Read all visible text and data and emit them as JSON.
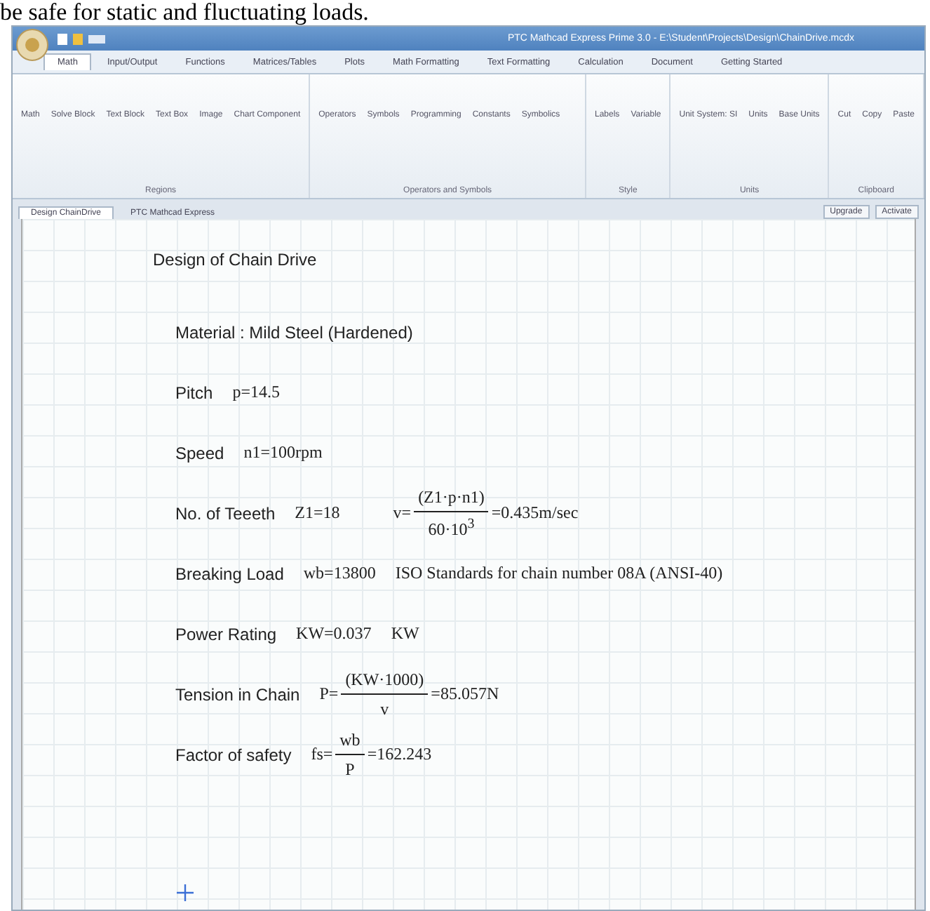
{
  "page_text": "be safe for static and fluctuating loads.",
  "window": {
    "title": "PTC Mathcad Express Prime 3.0 - E:\\Student\\Projects\\Design\\ChainDrive.mcdx"
  },
  "ribbon_tabs": [
    {
      "label": "Math",
      "selected": true
    },
    {
      "label": "Input/Output",
      "selected": false
    },
    {
      "label": "Functions",
      "selected": false
    },
    {
      "label": "Matrices/Tables",
      "selected": false
    },
    {
      "label": "Plots",
      "selected": false
    },
    {
      "label": "Math Formatting",
      "selected": false
    },
    {
      "label": "Text Formatting",
      "selected": false
    },
    {
      "label": "Calculation",
      "selected": false
    },
    {
      "label": "Document",
      "selected": false
    },
    {
      "label": "Getting Started",
      "selected": false
    }
  ],
  "ribbon_groups": [
    {
      "name": "Regions",
      "buttons": [
        "Math",
        "Solve Block",
        "Text Block",
        "Text Box",
        "Image",
        "Chart Component"
      ]
    },
    {
      "name": "Operators and Symbols",
      "buttons": [
        "Operators",
        "Symbols",
        "Programming",
        "Constants",
        "Symbolics"
      ]
    },
    {
      "name": "Style",
      "buttons": [
        "Labels",
        "Variable"
      ]
    },
    {
      "name": "Units",
      "buttons": [
        "Unit System: SI",
        "Units",
        "Base Units"
      ]
    },
    {
      "name": "Clipboard",
      "buttons": [
        "Cut",
        "Copy",
        "Paste"
      ]
    }
  ],
  "doc_tabs": [
    {
      "label": "Design ChainDrive",
      "selected": true
    },
    {
      "label": "PTC Mathcad Express",
      "selected": false
    }
  ],
  "doc_actions": [
    "Upgrade",
    "Activate"
  ],
  "worksheet": {
    "heading": "Design of Chain Drive",
    "rows": [
      {
        "parts": [
          {
            "kind": "text",
            "text": "Material : Mild Steel (Hardened)"
          }
        ]
      },
      {
        "parts": [
          {
            "kind": "text",
            "text": "Pitch"
          },
          {
            "kind": "math",
            "text": "p=14.5"
          }
        ]
      },
      {
        "parts": [
          {
            "kind": "text",
            "text": "Speed"
          },
          {
            "kind": "math",
            "text": "n1=100rpm"
          }
        ]
      },
      {
        "parts": [
          {
            "kind": "text",
            "text": "No. of Teeeth"
          },
          {
            "kind": "math",
            "text": "Z1=18"
          },
          {
            "kind": "fraction",
            "lhs": "v=",
            "num": "(Z1·p·n1)",
            "den": "60·10$^{3}$",
            "rhs": "=0.435m/sec"
          }
        ]
      },
      {
        "parts": [
          {
            "kind": "text",
            "text": "Breaking Load"
          },
          {
            "kind": "math",
            "text": "wb=13800"
          },
          {
            "kind": "math",
            "text": "ISO Standards for chain number 08A (ANSI-40)"
          }
        ]
      },
      {
        "parts": [
          {
            "kind": "text",
            "text": "Power Rating"
          },
          {
            "kind": "math",
            "text": "KW=0.037"
          },
          {
            "kind": "math",
            "text": "KW"
          }
        ]
      },
      {
        "parts": [
          {
            "kind": "text",
            "text": "Tension in Chain"
          },
          {
            "kind": "fraction",
            "lhs": "P=",
            "num": "(KW·1000)",
            "den": "v",
            "rhs": "=85.057N"
          }
        ]
      },
      {
        "parts": [
          {
            "kind": "text",
            "text": "Factor of safety"
          },
          {
            "kind": "fraction",
            "lhs": "fs=",
            "num": "wb",
            "den": "P",
            "rhs": "=162.243"
          }
        ]
      }
    ]
  }
}
